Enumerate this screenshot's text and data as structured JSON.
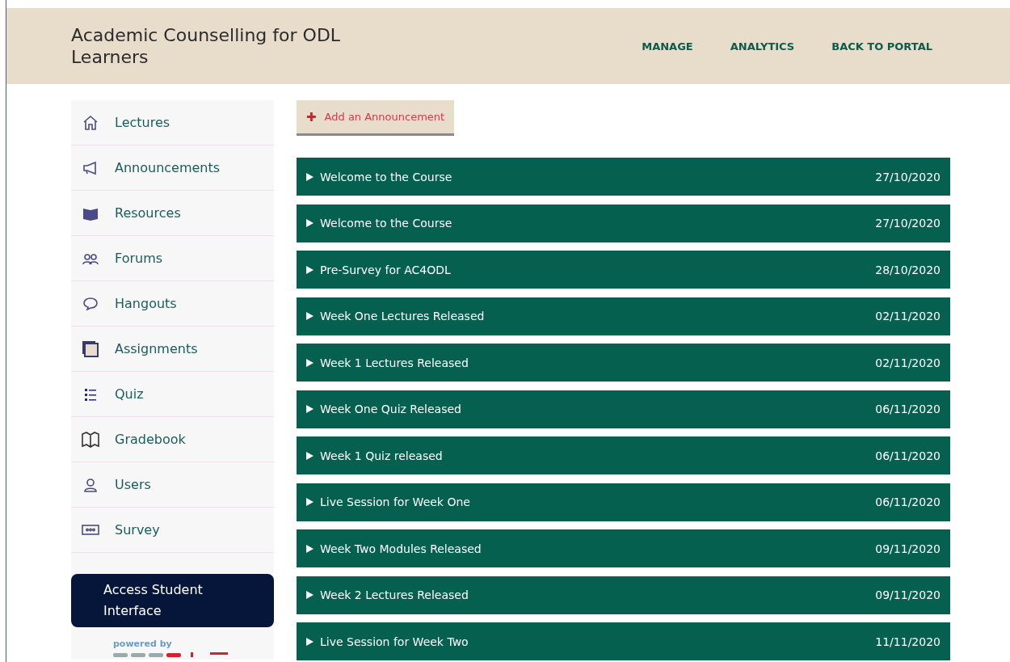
{
  "header": {
    "title": "Academic Counselling for ODL Learners",
    "nav": [
      "MANAGE",
      "ANALYTICS",
      "BACK TO PORTAL"
    ]
  },
  "sidebar": {
    "items": [
      {
        "label": "Lectures",
        "kind": "home"
      },
      {
        "label": "Announcements",
        "kind": "megaphone"
      },
      {
        "label": "Resources",
        "kind": "book"
      },
      {
        "label": "Forums",
        "kind": "people"
      },
      {
        "label": "Hangouts",
        "kind": "chat"
      },
      {
        "label": "Assignments",
        "kind": "stack"
      },
      {
        "label": "Quiz",
        "kind": "list"
      },
      {
        "label": "Gradebook",
        "kind": "openbook"
      },
      {
        "label": "Users",
        "kind": "user"
      },
      {
        "label": "Survey",
        "kind": "survey"
      }
    ],
    "student_button": "Access Student Interface",
    "powered_by": "powered by"
  },
  "add_button": {
    "icon": "✚",
    "label": "Add an Announcement"
  },
  "announcements": [
    {
      "title": "Welcome to the Course",
      "date": "27/10/2020"
    },
    {
      "title": "Welcome to the Course",
      "date": "27/10/2020"
    },
    {
      "title": "Pre-Survey for AC4ODL",
      "date": "28/10/2020"
    },
    {
      "title": "Week One Lectures Released",
      "date": "02/11/2020"
    },
    {
      "title": "Week 1 Lectures Released",
      "date": "02/11/2020"
    },
    {
      "title": "Week One Quiz Released",
      "date": "06/11/2020"
    },
    {
      "title": "Week 1 Quiz released",
      "date": "06/11/2020"
    },
    {
      "title": "Live Session for Week One",
      "date": "06/11/2020"
    },
    {
      "title": "Week Two Modules Released",
      "date": "09/11/2020"
    },
    {
      "title": "Week 2 Lectures Released",
      "date": "09/11/2020"
    },
    {
      "title": "Live Session for Week Two",
      "date": "11/11/2020"
    }
  ]
}
